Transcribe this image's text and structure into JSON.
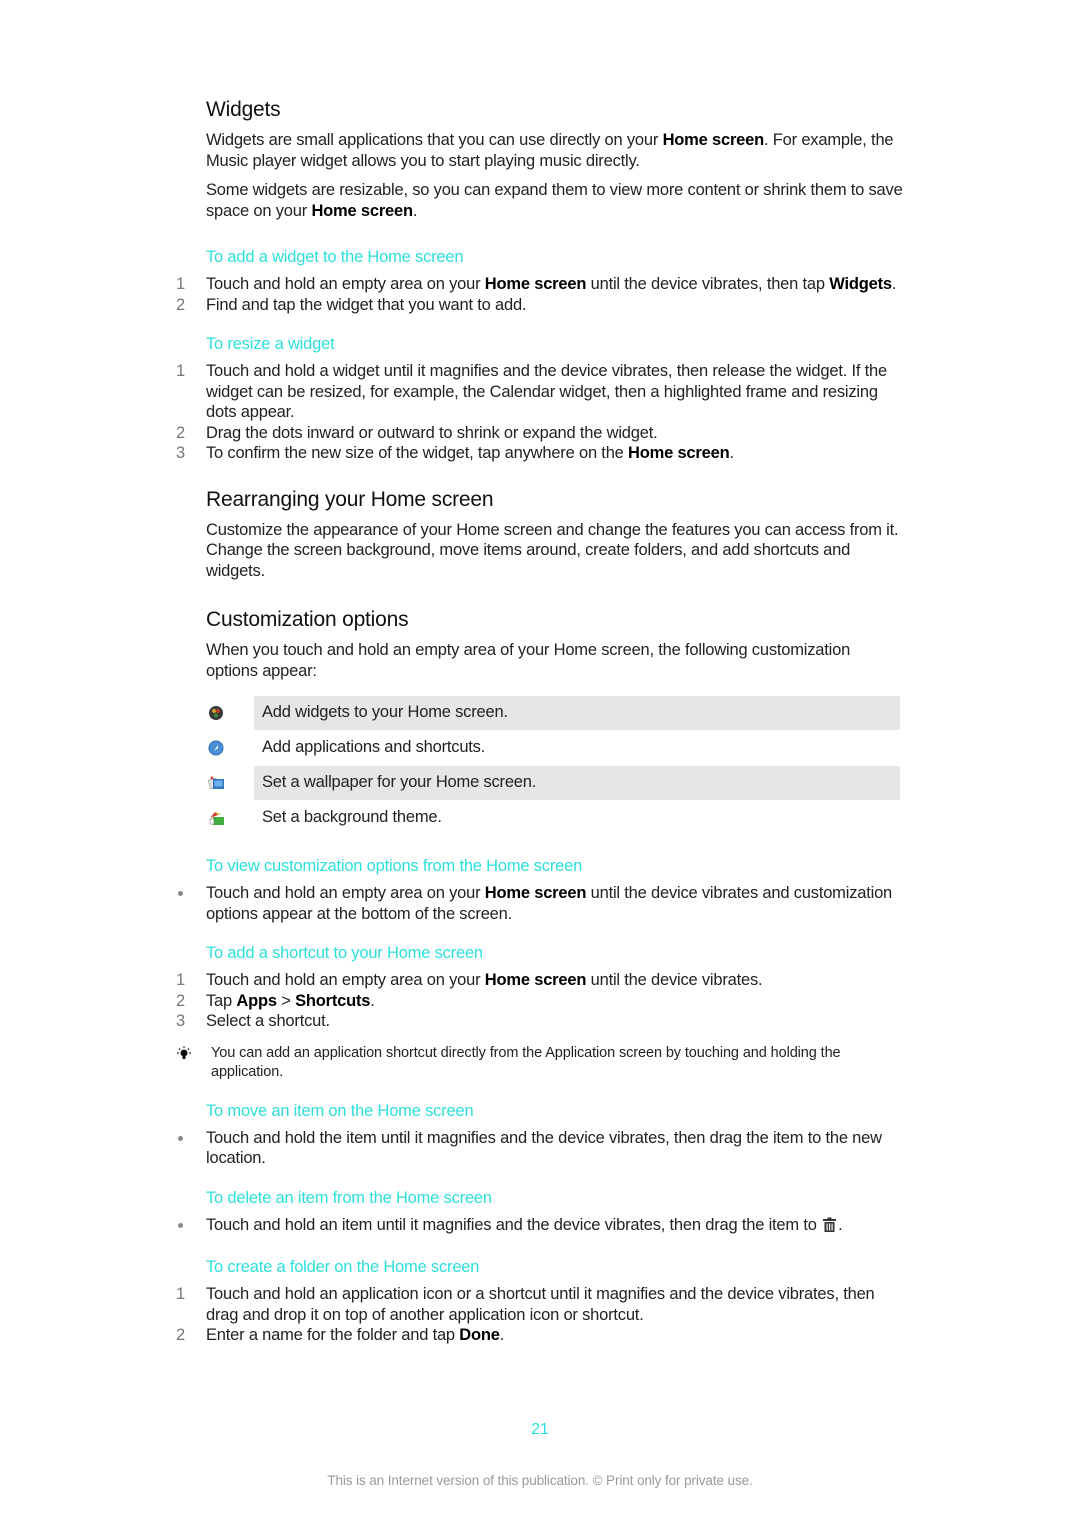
{
  "sections": {
    "widgets": {
      "title": "Widgets",
      "para1": {
        "pre": "Widgets are small applications that you can use directly on your ",
        "bold": "Home screen",
        "post": ". For example, the Music player widget allows you to start playing music directly."
      },
      "para2": {
        "pre": "Some widgets are resizable, so you can expand them to view more content or shrink them to save space on your ",
        "bold": "Home screen",
        "post": "."
      }
    },
    "add_widget": {
      "heading": "To add a widget to the Home screen",
      "steps": [
        {
          "num": "1",
          "pre": "Touch and hold an empty area on your ",
          "bold": "Home screen",
          "mid": " until the device vibrates, then tap ",
          "bold2": "Widgets",
          "post": "."
        },
        {
          "num": "2",
          "text": "Find and tap the widget that you want to add."
        }
      ]
    },
    "resize_widget": {
      "heading": "To resize a widget",
      "steps": [
        {
          "num": "1",
          "text": "Touch and hold a widget until it magnifies and the device vibrates, then release the widget. If the widget can be resized, for example, the Calendar widget, then a highlighted frame and resizing dots appear."
        },
        {
          "num": "2",
          "text": "Drag the dots inward or outward to shrink or expand the widget."
        },
        {
          "num": "3",
          "pre": "To confirm the new size of the widget, tap anywhere on the ",
          "bold": "Home screen",
          "post": "."
        }
      ]
    },
    "rearranging": {
      "title": "Rearranging your Home screen",
      "para": "Customize the appearance of your Home screen and change the features you can access from it. Change the screen background, move items around, create folders, and add shortcuts and widgets."
    },
    "customization": {
      "title": "Customization options",
      "para": "When you touch and hold an empty area of your Home screen, the following customization options appear:",
      "options": [
        {
          "icon": "widgets-icon",
          "text": "Add widgets to your Home screen."
        },
        {
          "icon": "apps-shortcuts-icon",
          "text": "Add applications and shortcuts."
        },
        {
          "icon": "wallpaper-icon",
          "text": "Set a wallpaper for your Home screen."
        },
        {
          "icon": "theme-icon",
          "text": "Set a background theme."
        }
      ]
    },
    "view_options": {
      "heading": "To view customization options from the Home screen",
      "bullet": {
        "pre": "Touch and hold an empty area on your ",
        "bold": "Home screen",
        "post": " until the device vibrates and customization options appear at the bottom of the screen."
      }
    },
    "add_shortcut": {
      "heading": "To add a shortcut to your Home screen",
      "steps": [
        {
          "num": "1",
          "pre": "Touch and hold an empty area on your ",
          "bold": "Home screen",
          "post": " until the device vibrates."
        },
        {
          "num": "2",
          "pre": "Tap ",
          "bold": "Apps",
          "mid": " > ",
          "bold2": "Shortcuts",
          "post": "."
        },
        {
          "num": "3",
          "text": "Select a shortcut."
        }
      ],
      "tip": "You can add an application shortcut directly from the Application screen by touching and holding the application."
    },
    "move_item": {
      "heading": "To move an item on the Home screen",
      "bullet": "Touch and hold the item until it magnifies and the device vibrates, then drag the item to the new location."
    },
    "delete_item": {
      "heading": "To delete an item from the Home screen",
      "bullet_pre": "Touch and hold an item until it magnifies and the device vibrates, then drag the item to ",
      "bullet_post": "."
    },
    "create_folder": {
      "heading": "To create a folder on the Home screen",
      "steps": [
        {
          "num": "1",
          "text": "Touch and hold an application icon or a shortcut until it magnifies and the device vibrates, then drag and drop it on top of another application icon or shortcut."
        },
        {
          "num": "2",
          "pre": "Enter a name for the folder and tap ",
          "bold": "Done",
          "post": "."
        }
      ]
    }
  },
  "page_number": "21",
  "footer": "This is an Internet version of this publication. © Print only for private use.",
  "colors": {
    "accent": "#2de0dc",
    "shade": "#e6e6e6",
    "text": "#222222"
  }
}
